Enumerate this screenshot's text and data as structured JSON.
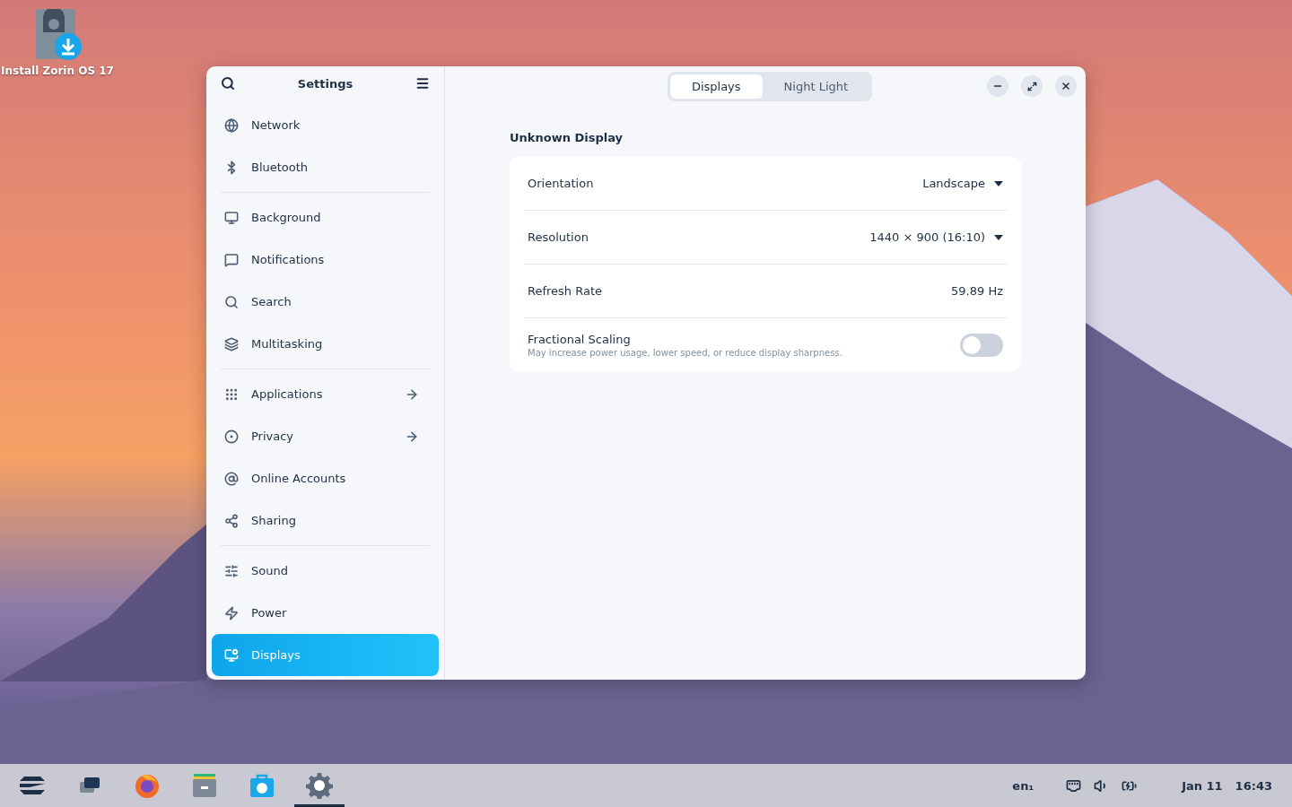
{
  "desktop_icons": [
    {
      "label": "Install Zorin OS 17"
    }
  ],
  "window": {
    "title": "Settings",
    "sidebar": {
      "groups": [
        {
          "items": [
            {
              "label": "Network",
              "selected": false,
              "arrow": false
            },
            {
              "label": "Bluetooth",
              "selected": false,
              "arrow": false
            }
          ]
        },
        {
          "items": [
            {
              "label": "Background",
              "selected": false,
              "arrow": false
            },
            {
              "label": "Notifications",
              "selected": false,
              "arrow": false
            },
            {
              "label": "Search",
              "selected": false,
              "arrow": false
            },
            {
              "label": "Multitasking",
              "selected": false,
              "arrow": false
            }
          ]
        },
        {
          "items": [
            {
              "label": "Applications",
              "selected": false,
              "arrow": true
            },
            {
              "label": "Privacy",
              "selected": false,
              "arrow": true
            },
            {
              "label": "Online Accounts",
              "selected": false,
              "arrow": false
            },
            {
              "label": "Sharing",
              "selected": false,
              "arrow": false
            }
          ]
        },
        {
          "items": [
            {
              "label": "Sound",
              "selected": false,
              "arrow": false
            },
            {
              "label": "Power",
              "selected": false,
              "arrow": false
            },
            {
              "label": "Displays",
              "selected": true,
              "arrow": false
            }
          ]
        }
      ]
    },
    "tabs": [
      {
        "label": "Displays",
        "selected": true
      },
      {
        "label": "Night Light",
        "selected": false
      }
    ],
    "section_title": "Unknown Display",
    "rows": [
      {
        "kind": "dropdown",
        "label": "Orientation",
        "value": "Landscape"
      },
      {
        "kind": "dropdown",
        "label": "Resolution",
        "value": "1440 × 900 (16:10)"
      },
      {
        "kind": "value",
        "label": "Refresh Rate",
        "value": "59.89 Hz"
      },
      {
        "kind": "switch",
        "label": "Fractional Scaling",
        "subtitle": "May increase power usage, lower speed, or reduce display sharpness.",
        "on": false
      }
    ]
  },
  "taskbar": {
    "apps": [
      {
        "selected": false
      },
      {
        "selected": false
      },
      {
        "selected": false
      },
      {
        "selected": false
      },
      {
        "selected": false
      },
      {
        "selected": true
      }
    ],
    "keyboard": "en₁",
    "date": "Jan 11",
    "time": "16:43"
  }
}
